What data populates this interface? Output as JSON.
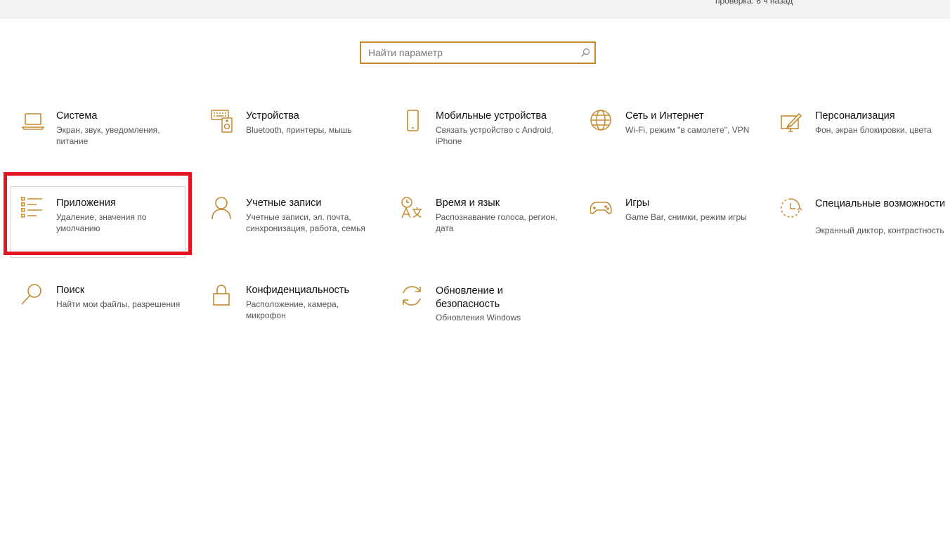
{
  "topbar": {
    "status_text": "проверка: 8 ч назад"
  },
  "search": {
    "placeholder": "Найти параметр"
  },
  "tiles": [
    {
      "icon": "laptop-icon",
      "title": "Система",
      "desc": "Экран, звук, уведомления, питание"
    },
    {
      "icon": "devices-icon",
      "title": "Устройства",
      "desc": "Bluetooth, принтеры, мышь"
    },
    {
      "icon": "phone-icon",
      "title": "Мобильные устройства",
      "desc": "Связать устройство с Android, iPhone"
    },
    {
      "icon": "globe-icon",
      "title": "Сеть и Интернет",
      "desc": "Wi-Fi, режим \"в самолете\", VPN"
    },
    {
      "icon": "personalization-icon",
      "title": "Персонализация",
      "desc": "Фон, экран блокировки, цвета"
    },
    {
      "icon": "apps-list-icon",
      "title": "Приложения",
      "desc": "Удаление, значения по умолчанию"
    },
    {
      "icon": "person-icon",
      "title": "Учетные записи",
      "desc": "Учетные записи, эл. почта, синхронизация, работа, семья"
    },
    {
      "icon": "time-language-icon",
      "title": "Время и язык",
      "desc": "Распознавание голоса, регион, дата"
    },
    {
      "icon": "gamepad-icon",
      "title": "Игры",
      "desc": "Game Bar, снимки, режим игры"
    },
    {
      "icon": "accessibility-timer-icon",
      "title": "Специальные возможности",
      "desc": "Экранный диктор, контрастность"
    },
    {
      "icon": "search-magnifier-icon",
      "title": "Поиск",
      "desc": "Найти мои файлы, разрешения"
    },
    {
      "icon": "lock-icon",
      "title": "Конфиденциальность",
      "desc": "Расположение, камера, микрофон"
    },
    {
      "icon": "update-sync-icon",
      "title": "Обновление и безопасность",
      "desc": "Обновления Windows"
    }
  ],
  "colors": {
    "accent": "#c58a2f",
    "highlight": "#e3131f"
  }
}
